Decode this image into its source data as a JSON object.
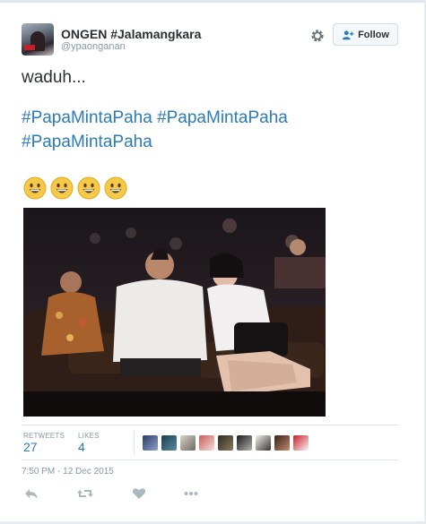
{
  "user": {
    "display_name": "ONGEN #Jalamangkara",
    "handle": "@ypaonganan",
    "avatar_icon": "user-avatar"
  },
  "header": {
    "settings_icon": "gear-icon",
    "follow_label": "Follow",
    "follow_icon": "person-plus-icon"
  },
  "tweet": {
    "line1": "waduh...",
    "hashtags": [
      "#PapaMintaPaha",
      "#PapaMintaPaha",
      "#PapaMintaPaha"
    ],
    "emoji_count": 4,
    "emoji_icon": "grinning-face-emoji",
    "photo": "tweet-photo"
  },
  "stats": {
    "retweets_label": "RETWEETS",
    "retweets_value": "27",
    "likes_label": "LIKES",
    "likes_value": "4",
    "likers_count": 9
  },
  "timestamp": "7:50 PM - 12 Dec 2015",
  "actions": [
    "reply-icon",
    "retweet-icon",
    "like-icon",
    "more-icon"
  ],
  "colors": {
    "link": "#2b7bb9",
    "muted": "#8899a6",
    "text": "#292f33"
  }
}
